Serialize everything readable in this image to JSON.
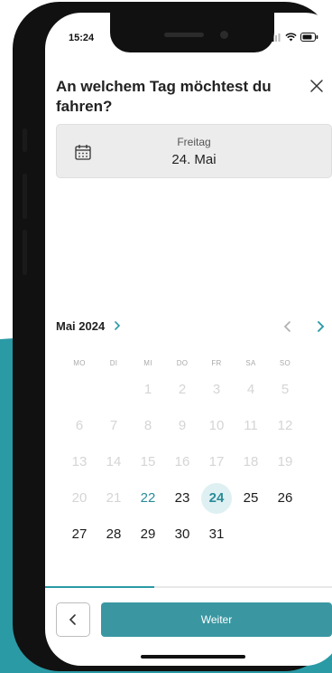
{
  "status_bar": {
    "time": "15:24"
  },
  "header": {
    "title": "An welchem Tag möchtest du fahren?"
  },
  "date_field": {
    "weekday": "Freitag",
    "date": "24. Mai"
  },
  "calendar": {
    "month_label": "Mai 2024",
    "weekdays": [
      "MO",
      "DI",
      "MI",
      "DO",
      "FR",
      "SA",
      "SO"
    ],
    "weeks": [
      [
        "",
        "",
        "1",
        "2",
        "3",
        "4",
        "5"
      ],
      [
        "6",
        "7",
        "8",
        "9",
        "10",
        "11",
        "12"
      ],
      [
        "13",
        "14",
        "15",
        "16",
        "17",
        "18",
        "19"
      ],
      [
        "20",
        "21",
        "22",
        "23",
        "24",
        "25",
        "26"
      ],
      [
        "27",
        "28",
        "29",
        "30",
        "31",
        "",
        ""
      ]
    ],
    "selected_day": "24",
    "today": "22",
    "first_enabled_day": 22
  },
  "progress": {
    "fraction": 0.37
  },
  "footer": {
    "next_label": "Weiter"
  },
  "colors": {
    "accent": "#2a9aa5",
    "button": "#3a97a2",
    "selected_bg": "#dff0f2"
  },
  "icons": {
    "close": "close-icon",
    "calendar": "calendar-icon",
    "month_chevron": "chevron-right-icon",
    "prev": "chevron-left-icon",
    "next": "chevron-right-icon",
    "back": "chevron-left-icon"
  }
}
